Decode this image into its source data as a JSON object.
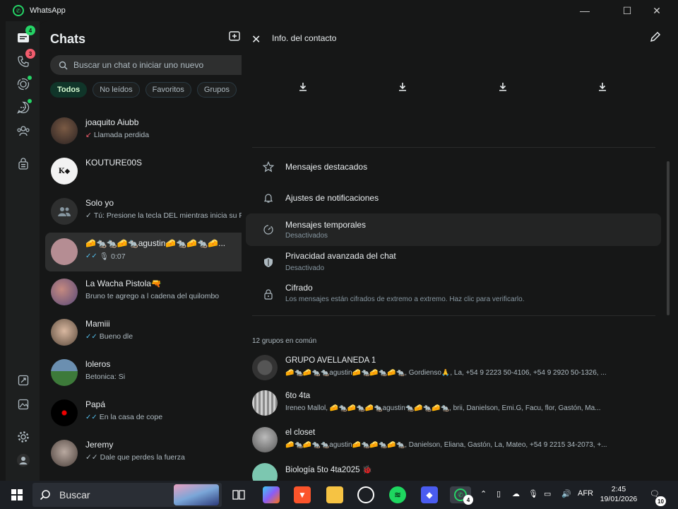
{
  "window": {
    "title": "WhatsApp",
    "minimize": "—",
    "maximize": "☐",
    "close": "✕"
  },
  "rail": {
    "chats_badge": "4",
    "calls_badge": "3"
  },
  "chats": {
    "title": "Chats",
    "search_placeholder": "Buscar un chat o iniciar uno nuevo",
    "filters": [
      "Todos",
      "No leídos",
      "Favoritos",
      "Grupos"
    ],
    "items": [
      {
        "name": "joaquito Aiubb",
        "preview": "Llamada perdida",
        "icon": "missed-call-icon"
      },
      {
        "name": "KOUTURE00S",
        "preview": ""
      },
      {
        "name": "Solo yo",
        "preview": "Tú: Presione la tecla DEL mientras inicia su PC",
        "icon": "check-icon"
      },
      {
        "name": "🧀🐀🐀🧀🐀agustin🧀🐀🧀🐀🧀...",
        "preview": "0:07",
        "icon": "mic-icon"
      },
      {
        "name": "La Wacha Pistola🔫",
        "preview": "Bruno te agrego a l cadena del quilombo"
      },
      {
        "name": "Mamiii",
        "preview": "Bueno dle",
        "icon": "double-check-icon"
      },
      {
        "name": "loleros",
        "preview": "Betonica: Si"
      },
      {
        "name": "Papá",
        "preview": "En la casa de cope",
        "icon": "double-check-icon"
      },
      {
        "name": "Jeremy",
        "preview": "Dale que perdes la fuerza",
        "icon": "double-check-icon"
      }
    ]
  },
  "panel": {
    "title": "Info. del contacto",
    "options": [
      {
        "label": "Mensajes destacados",
        "sub": ""
      },
      {
        "label": "Ajustes de notificaciones",
        "sub": ""
      },
      {
        "label": "Mensajes temporales",
        "sub": "Desactivados"
      },
      {
        "label": "Privacidad avanzada del chat",
        "sub": "Desactivado"
      },
      {
        "label": "Cifrado",
        "sub": "Los mensajes están cifrados de extremo a extremo. Haz clic para verificarlo."
      }
    ],
    "groups_header": "12 grupos en común",
    "groups": [
      {
        "name": "GRUPO AVELLANEDA 1",
        "members": "🧀🐀🧀🐀🐀agustin🧀🐀🧀🐀🧀🐀, Gordienso🙏, La, +54 9 2223 50-4106, +54 9 2920 50-1326, ..."
      },
      {
        "name": "6to 4ta",
        "members": "Ireneo Mallol, 🧀🐀🧀🐀🧀🐀agustin🐀🧀🐀🧀🐀, brii, Danielson, Emi.G, Facu, flor, Gastón, Ma..."
      },
      {
        "name": "el closet",
        "members": "🧀🐀🧀🐀🐀agustin🧀🐀🧀🐀🧀🐀, Danielson, Eliana, Gastón, La, Mateo, +54 9 2215 34-2073, +..."
      },
      {
        "name": "Biología 5to 4ta2025 🐞",
        "members": ""
      }
    ]
  },
  "taskbar": {
    "search_placeholder": "Buscar",
    "whatsapp_badge": "4",
    "language": "AFR",
    "time": "2:45",
    "date": "19/01/2026",
    "notifications": "10"
  }
}
